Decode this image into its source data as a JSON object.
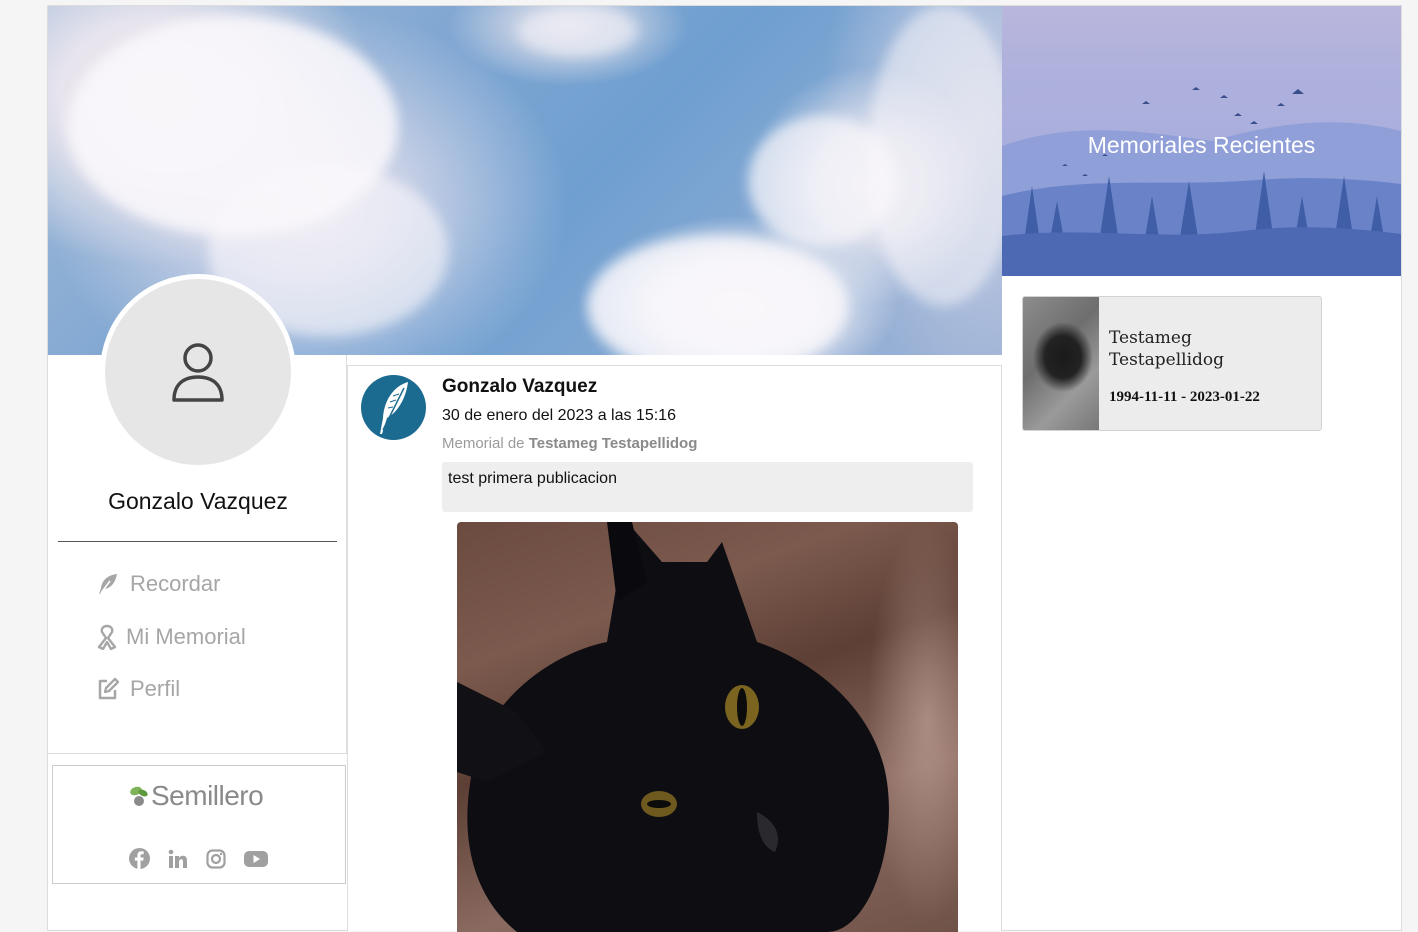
{
  "profile": {
    "name": "Gonzalo Vazquez"
  },
  "nav": {
    "items": [
      {
        "label": "Recordar",
        "icon": "feather-icon"
      },
      {
        "label": "Mi Memorial",
        "icon": "ribbon-icon"
      },
      {
        "label": "Perfil",
        "icon": "edit-icon"
      }
    ]
  },
  "sponsor": {
    "name": "Semillero",
    "socials": [
      "facebook-icon",
      "linkedin-icon",
      "instagram-icon",
      "youtube-icon"
    ]
  },
  "post": {
    "author": "Gonzalo Vazquez",
    "date": "30 de enero del 2023 a las 15:16",
    "memorial_prefix": "Memorial de",
    "memorial_name": "Testameg Testapellidog",
    "text": "test primera publicacion"
  },
  "recent": {
    "title": "Memoriales Recientes",
    "cards": [
      {
        "name": "Testameg Testapellidog",
        "dates": "1994-11-11 - 2023-01-22"
      }
    ]
  },
  "colors": {
    "post_avatar_bg": "#1b6a90",
    "nav_text": "#a6a6a6",
    "text_box_bg": "#eeeeee"
  }
}
